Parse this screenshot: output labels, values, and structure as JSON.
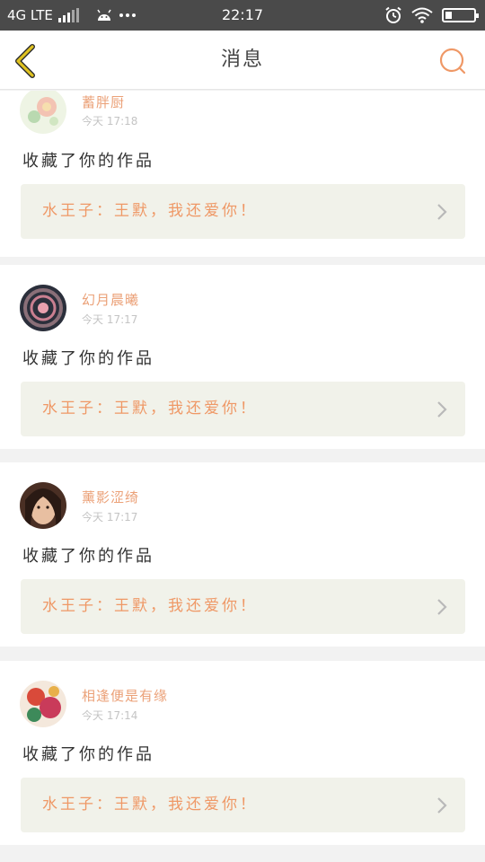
{
  "status_bar": {
    "network": "4G LTE",
    "time": "22:17",
    "icons": [
      "signal-icon",
      "android-icon",
      "more-icon",
      "alarm-icon",
      "wifi-icon",
      "battery-icon"
    ]
  },
  "header": {
    "title": "消息",
    "back_icon": "chevron-left-icon",
    "search_icon": "search-icon"
  },
  "colors": {
    "accent_orange": "#ef9866",
    "back_yellow": "#e0c321",
    "link_bg": "#f1f2ea",
    "status_bar_bg": "#4a4a4a"
  },
  "messages": [
    {
      "username": "蓄胖厨",
      "time": "今天 17:18",
      "action": "收藏了你的作品",
      "work": "水王子：王默，我还爱你！"
    },
    {
      "username": "幻月晨曦",
      "time": "今天 17:17",
      "action": "收藏了你的作品",
      "work": "水王子：王默，我还爱你！"
    },
    {
      "username": "薰影涩绮",
      "time": "今天 17:17",
      "action": "收藏了你的作品",
      "work": "水王子：王默，我还爱你！"
    },
    {
      "username": "相逢便是有缘",
      "time": "今天 17:14",
      "action": "收藏了你的作品",
      "work": "水王子：王默，我还爱你！"
    }
  ]
}
